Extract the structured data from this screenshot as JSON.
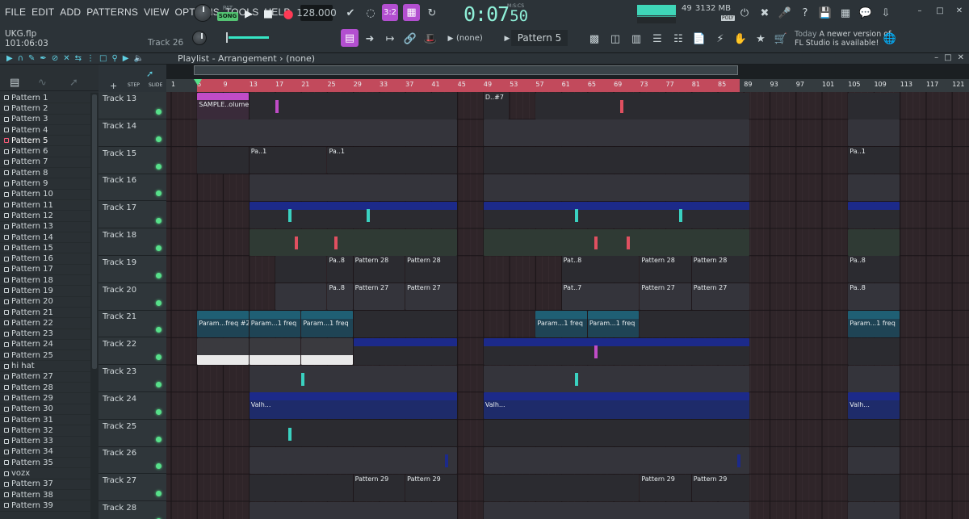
{
  "menu": [
    "FILE",
    "EDIT",
    "ADD",
    "PATTERNS",
    "VIEW",
    "OPTIONS",
    "TOOLS",
    "HELP"
  ],
  "project": {
    "file": "UKG.flp",
    "position": "101:06:03",
    "hint_track": "Track 26"
  },
  "transport": {
    "pat_label": "PAT",
    "song_label": "SONG",
    "tempo": "128.000"
  },
  "time": {
    "main": "0:07",
    "sub": "50",
    "unit": "M:S:CS"
  },
  "monitor": {
    "cpu": "49",
    "memory": "3132 MB",
    "polyphony": "52"
  },
  "toolbar2": {
    "none_label": "(none)",
    "pattern": "Pattern 5"
  },
  "news": {
    "when": "Today",
    "line1": "A newer version of",
    "line2": "FL Studio is available!"
  },
  "playlist": {
    "title": "Playlist - Arrangement",
    "selection": "(none)"
  },
  "browser": {
    "patterns": [
      "Pattern 1",
      "Pattern 2",
      "Pattern 3",
      "Pattern 4",
      "Pattern 5",
      "Pattern 6",
      "Pattern 7",
      "Pattern 8",
      "Pattern 9",
      "Pattern 10",
      "Pattern 11",
      "Pattern 12",
      "Pattern 13",
      "Pattern 14",
      "Pattern 15",
      "Pattern 16",
      "Pattern 17",
      "Pattern 18",
      "Pattern 19",
      "Pattern 20",
      "Pattern 21",
      "Pattern 22",
      "Pattern 23",
      "Pattern 24",
      "Pattern 25",
      "hi hat",
      "Pattern 27",
      "Pattern 28",
      "Pattern 29",
      "Pattern 30",
      "Pattern 31",
      "Pattern 32",
      "Pattern 33",
      "Pattern 34",
      "Pattern 35",
      "vozx",
      "Pattern 37",
      "Pattern 38",
      "Pattern 39"
    ],
    "selected_index": 4
  },
  "tracks": [
    "Track 13",
    "Track 14",
    "Track 15",
    "Track 16",
    "Track 17",
    "Track 18",
    "Track 19",
    "Track 20",
    "Track 21",
    "Track 22",
    "Track 23",
    "Track 24",
    "Track 25",
    "Track 26",
    "Track 27",
    "Track 28"
  ],
  "ruler": [
    "1",
    "5",
    "9",
    "13",
    "17",
    "21",
    "25",
    "29",
    "33",
    "37",
    "41",
    "45",
    "49",
    "53",
    "57",
    "61",
    "65",
    "69",
    "73",
    "77",
    "81",
    "85",
    "89",
    "93",
    "97",
    "101",
    "105",
    "109",
    "113",
    "117",
    "121"
  ],
  "clip_labels": {
    "sample_vol": "SAMPLE..olume",
    "d87": "D..#7",
    "pa1": "Pa..1",
    "pa8": "Pa..8",
    "pat28": "Pattern 28",
    "pat27": "Pattern 27",
    "pat29": "Pattern 29",
    "param2": "Param...freq #2",
    "param1": "Param...1 freq",
    "valh": "Valh...",
    "pat8": "Pat..8",
    "pat7": "Pat..7"
  },
  "colors": {
    "accent": "#36e5c4",
    "selection": "#c24a5c",
    "led": "#57e08a",
    "clip_blue": "#1c2a8a",
    "clip_teal": "#2a6e86"
  }
}
